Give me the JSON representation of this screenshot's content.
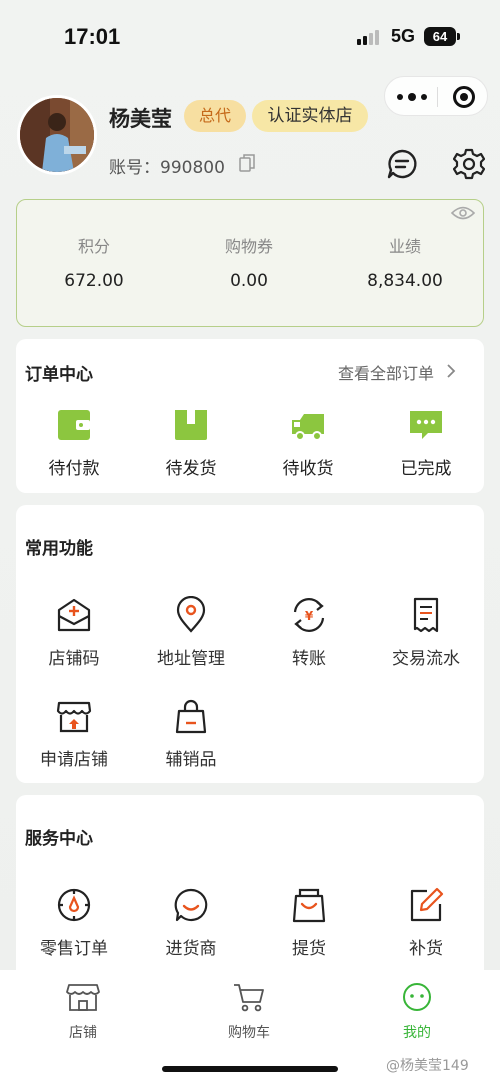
{
  "status_bar": {
    "time": "17:01",
    "network": "5G",
    "battery": "64"
  },
  "profile": {
    "name": "杨美莹",
    "badge_agent": "总代",
    "badge_store": "认证实体店",
    "account": "账号：990800"
  },
  "stats": [
    {
      "label": "积分",
      "value": "672.00"
    },
    {
      "label": "购物券",
      "value": "0.00"
    },
    {
      "label": "业绩",
      "value": "8,834.00"
    }
  ],
  "order_center": {
    "title": "订单中心",
    "view_all": "查看全部订单",
    "items": [
      {
        "label": "待付款",
        "icon": "wallet-icon"
      },
      {
        "label": "待发货",
        "icon": "package-icon"
      },
      {
        "label": "待收货",
        "icon": "truck-icon"
      },
      {
        "label": "已完成",
        "icon": "chat-done-icon"
      }
    ]
  },
  "common_functions": {
    "title": "常用功能",
    "items": [
      {
        "label": "店铺码",
        "icon": "store-code-icon"
      },
      {
        "label": "地址管理",
        "icon": "location-icon"
      },
      {
        "label": "转账",
        "icon": "transfer-icon"
      },
      {
        "label": "交易流水",
        "icon": "receipt-icon"
      },
      {
        "label": "申请店铺",
        "icon": "shop-apply-icon"
      },
      {
        "label": "辅销品",
        "icon": "bag-icon"
      }
    ]
  },
  "service_center": {
    "title": "服务中心",
    "items": [
      {
        "label": "零售订单",
        "icon": "compass-icon"
      },
      {
        "label": "进货商",
        "icon": "smile-chat-icon"
      },
      {
        "label": "提货",
        "icon": "pickup-bag-icon"
      },
      {
        "label": "补货",
        "icon": "edit-icon"
      }
    ]
  },
  "tabbar": [
    {
      "label": "店铺",
      "icon": "shop-icon"
    },
    {
      "label": "购物车",
      "icon": "cart-icon"
    },
    {
      "label": "我的",
      "icon": "me-icon"
    }
  ],
  "watermark": "@杨美莹149",
  "colors": {
    "accent": "#8cc63f",
    "active_tab": "#38b538",
    "icon_orange": "#e8541e"
  }
}
